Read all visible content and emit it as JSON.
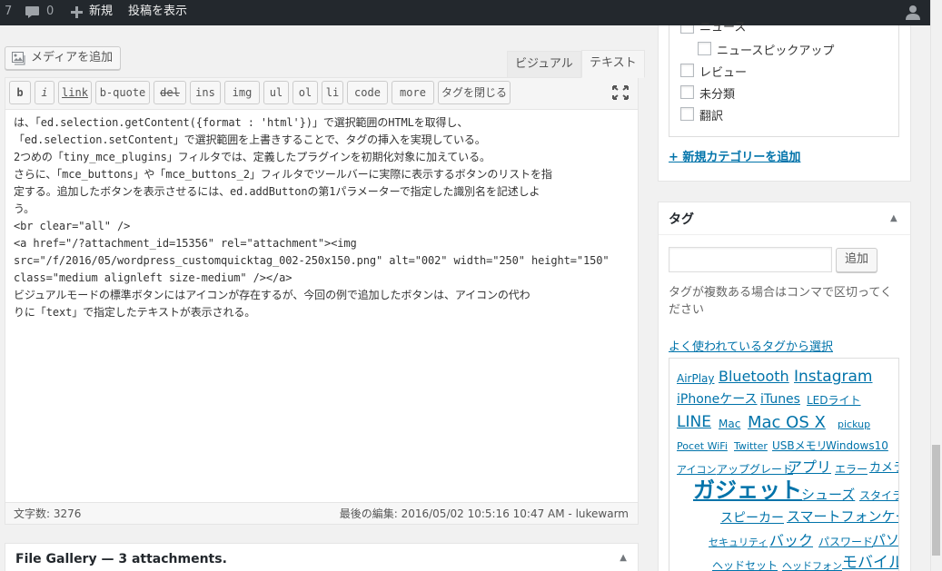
{
  "adminbar": {
    "count_fragment": "7",
    "comments_count": "0",
    "new_label": "新規",
    "view_post_label": "投稿を表示"
  },
  "editor": {
    "add_media_label": "メディアを追加",
    "tabs": {
      "visual": "ビジュアル",
      "text": "テキスト"
    },
    "quicktags": [
      "b",
      "i",
      "link",
      "b-quote",
      "del",
      "ins",
      "img",
      "ul",
      "ol",
      "li",
      "code",
      "more",
      "タグを閉じる"
    ],
    "content": [
      "は、「ed.selection.getContent({format : 'html'})」で選択範囲のHTMLを取得し、",
      "「ed.selection.setContent」で選択範囲を上書きすることで、タグの挿入を実現している。",
      "",
      "2つめの「tiny_mce_plugins」フィルタでは、定義したプラグインを初期化対象に加えている。",
      "さらに、「mce_buttons」や「mce_buttons_2」フィルタでツールバーに実際に表示するボタンのリストを指",
      "定する。追加したボタンを表示させるには、ed.addButtonの第1パラメーターで指定した識別名を記述しよ",
      "う。",
      "",
      "",
      "<br clear=\"all\" />",
      "",
      "",
      "<a href=\"/?attachment_id=15356\" rel=\"attachment\"><img",
      "src=\"/f/2016/05/wordpress_customquicktag_002-250x150.png\" alt=\"002\" width=\"250\" height=\"150\"",
      "class=\"medium alignleft size-medium\" /></a>",
      "",
      "ビジュアルモードの標準ボタンにはアイコンが存在するが、今回の例で追加したボタンは、アイコンの代わ",
      "りに「text」で指定したテキストが表示される。"
    ],
    "word_count": "文字数: 3276",
    "last_edited": "最後の編集: 2016/05/02 10:5:16 10:47 AM - lukewarm"
  },
  "file_gallery": {
    "title": "File Gallery — 3 attachments."
  },
  "categories": {
    "items": [
      {
        "label": "ニュース",
        "checked": false
      },
      {
        "label": "ニュースピックアップ",
        "checked": false
      },
      {
        "label": "レビュー",
        "checked": false
      },
      {
        "label": "未分類",
        "checked": false
      },
      {
        "label": "翻訳",
        "checked": false
      }
    ],
    "add_new_link": "+ 新規カテゴリーを追加"
  },
  "tags_box": {
    "title": "タグ",
    "input_value": "",
    "add_button": "追加",
    "help": "タグが複数ある場合はコンマで区切ってください",
    "choose_link": "よく使われているタグから選択",
    "cloud": [
      "AirPlay",
      "Bluetooth",
      "Instagram",
      "iPhoneケース",
      "iTunes",
      "LEDライト",
      "LINE",
      "Mac",
      "Mac OS X",
      "pickup",
      "Pocet WiFi",
      "Twitter",
      "USBメモリ",
      "Windows10",
      "アイコン",
      "アップグレード",
      "アプリ",
      "エラー",
      "カメラ",
      "ガジェット",
      "シューズ",
      "スタイラスペン",
      "スピーカー",
      "スマートフォンケース",
      "セキュリティ",
      "バック",
      "パスワード",
      "パソコン",
      "ヘッドセット",
      "ヘッドフォン",
      "モバイル"
    ]
  },
  "colors": {
    "adminbar": "#23282d",
    "link": "#0073aa"
  }
}
